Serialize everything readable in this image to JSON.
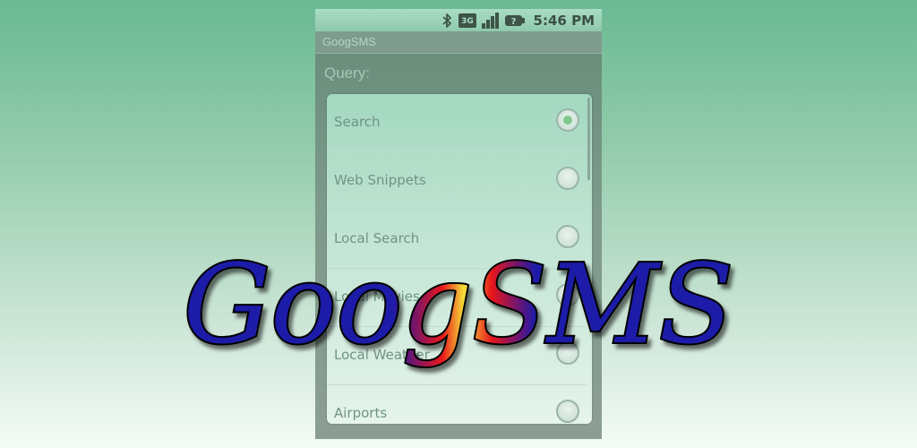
{
  "status_bar": {
    "time": "5:46 PM",
    "icons": [
      "bluetooth-icon",
      "3g-icon",
      "signal-icon",
      "battery-unknown-icon"
    ],
    "network_label": "3G"
  },
  "app": {
    "title": "GoogSMS",
    "query_label": "Query:"
  },
  "dialog": {
    "options": [
      {
        "label": "Search",
        "selected": true
      },
      {
        "label": "Web Snippets",
        "selected": false
      },
      {
        "label": "Local Search",
        "selected": false
      },
      {
        "label": "Local Movies",
        "selected": false
      },
      {
        "label": "Local Weather",
        "selected": false
      },
      {
        "label": "Airports",
        "selected": false
      }
    ]
  },
  "banner": {
    "logo_text": "GoogSMS",
    "logo_colors": [
      "#1d1aa8",
      "#e8161c",
      "#f6e23a"
    ]
  },
  "colors": {
    "accent": "#7fc98f",
    "background_top": "#6ab994",
    "background_bottom": "#f4fbf7"
  }
}
